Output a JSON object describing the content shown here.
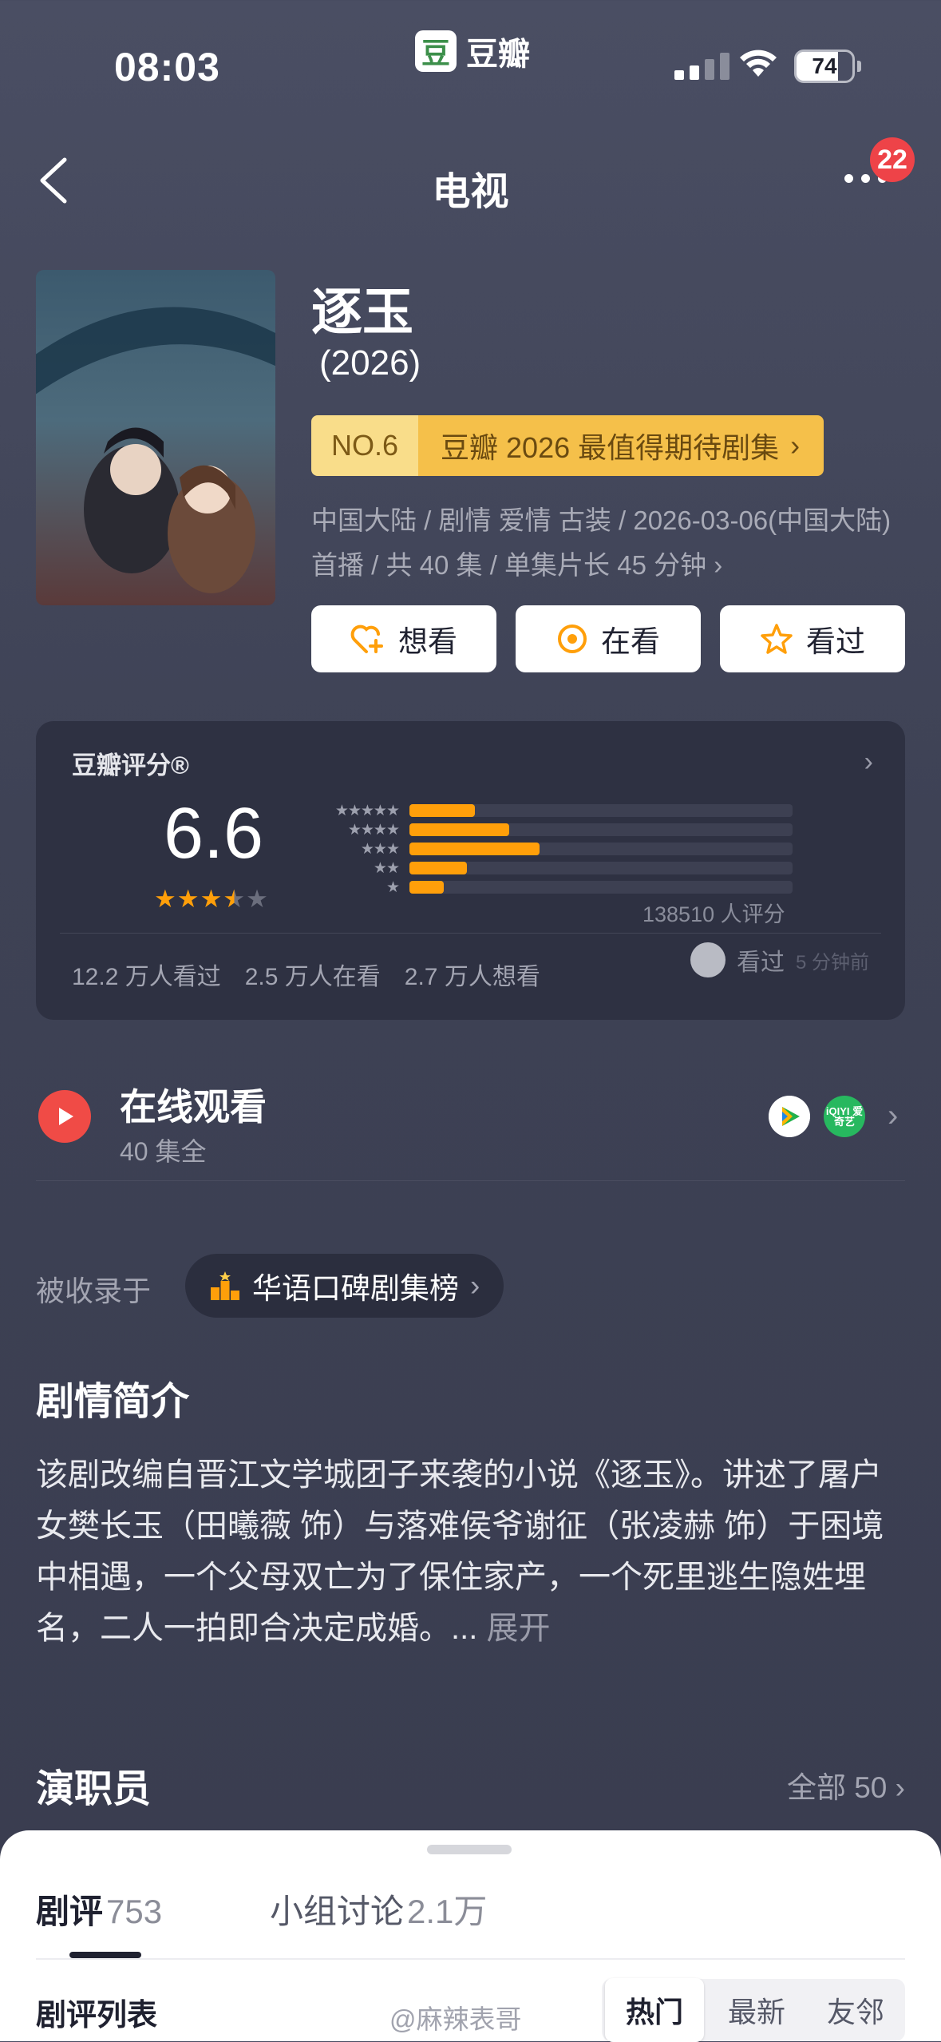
{
  "status_bar": {
    "time": "08:03",
    "app_name": "豆瓣",
    "app_logo": "豆",
    "battery": "74"
  },
  "nav": {
    "title": "电视",
    "notifications": "22"
  },
  "show": {
    "title": "逐玉",
    "year": "(2026)",
    "rank_no": "NO.6",
    "rank_text": "豆瓣 2026 最值得期待剧集",
    "meta": "中国大陆 / 剧情 爱情 古装 / 2026-03-06(中国大陆) 首播 / 共 40 集 / 单集片长 45 分钟",
    "actions": {
      "want": "想看",
      "watching": "在看",
      "watched": "看过"
    }
  },
  "rating": {
    "label": "豆瓣评分®",
    "score": "6.6",
    "star_value": 3.5,
    "distribution": [
      {
        "stars": "★★★★★",
        "pct": 17
      },
      {
        "stars": "★★★★",
        "pct": 26
      },
      {
        "stars": "★★★",
        "pct": 34
      },
      {
        "stars": "★★",
        "pct": 15
      },
      {
        "stars": "★",
        "pct": 9
      }
    ],
    "count": "138510 人评分",
    "stats": [
      "12.2 万人看过",
      "2.5 万人在看",
      "2.7 万人想看"
    ],
    "recent_action": "看过",
    "recent_time": "5 分钟前"
  },
  "watch": {
    "title": "在线观看",
    "subtitle": "40 集全",
    "platform2": "iQIYI 爱奇艺"
  },
  "collected": {
    "label": "被收录于",
    "list": "华语口碑剧集榜"
  },
  "synopsis": {
    "title": "剧情简介",
    "text": "该剧改编自晋江文学城团子来袭的小说《逐玉》。讲述了屠户女樊长玉（田曦薇 饰）与落难侯爷谢征（张凌赫 饰）于困境中相遇，一个父母双亡为了保住家产，一个死里逃生隐姓埋名，二人一拍即合决定成婚。... ",
    "more": "展开"
  },
  "cast": {
    "title": "演职员",
    "all": "全部 50"
  },
  "sheet": {
    "tab_reviews": "剧评",
    "tab_reviews_count": "753",
    "tab_group": "小组讨论",
    "tab_group_count": "2.1万",
    "list_label": "剧评列表",
    "segments": [
      "热门",
      "最新",
      "友邻"
    ],
    "watermark": "@麻辣表哥"
  },
  "colors": {
    "accent_orange": "#ff9f0a",
    "badge_red": "#ee4348",
    "play_red": "#f04b46"
  }
}
